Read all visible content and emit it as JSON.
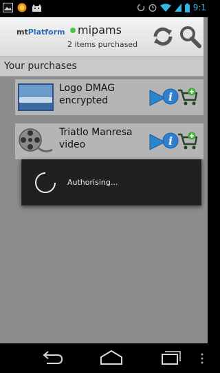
{
  "status_bar": {
    "time": "9:1",
    "left_icons": [
      "gallery-icon",
      "notification-icon",
      "cat-icon"
    ],
    "right_icons": [
      "sync-icon",
      "alarm-icon",
      "wifi-icon",
      "signal-icon",
      "battery-icon"
    ],
    "accent_color": "#33b5e5"
  },
  "header": {
    "logo_prefix": "mt",
    "logo_suffix": "Platform",
    "username": "mipams",
    "status": "2 items purchased",
    "online_color": "#4fc24a",
    "refresh_icon": "refresh-icon",
    "search_icon": "search-icon"
  },
  "section": {
    "title": "Your purchases"
  },
  "items": [
    {
      "title": "Logo DMAG encrypted",
      "thumb": "image-thumbnail"
    },
    {
      "title": "Triatlo Manresa video",
      "thumb": "film-reel-icon"
    }
  ],
  "item_actions": [
    "play-icon",
    "info-icon",
    "add-to-cart-icon"
  ],
  "dialog": {
    "message": "Authorising..."
  },
  "nav": {
    "buttons": [
      "back-icon",
      "home-icon",
      "recent-apps-icon",
      "menu-icon"
    ]
  }
}
